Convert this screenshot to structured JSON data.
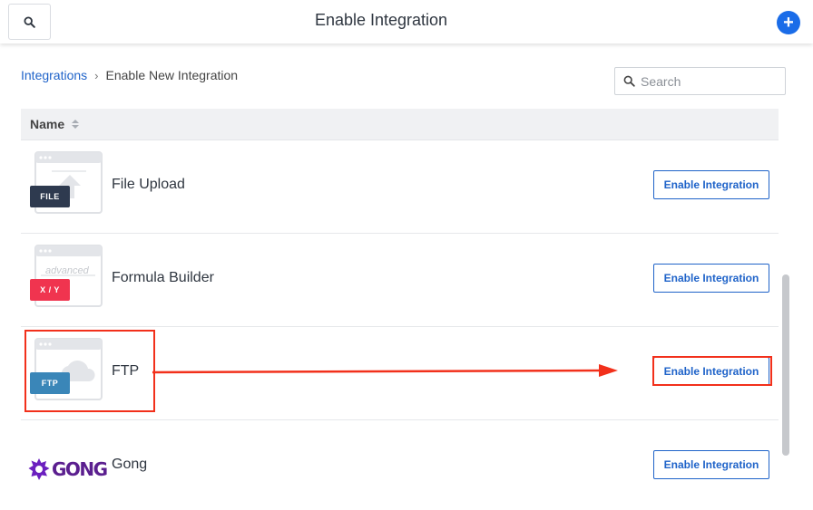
{
  "header": {
    "title": "Enable Integration",
    "search_icon": "search-icon",
    "add_icon": "plus-icon",
    "add_label": "+"
  },
  "breadcrumb": {
    "root": "Integrations",
    "separator": "›",
    "current": "Enable New Integration"
  },
  "search": {
    "placeholder": "Search",
    "value": ""
  },
  "table": {
    "column_name": "Name",
    "rows": [
      {
        "name": "File Upload",
        "badge": "FILE",
        "badge_color": "#2e3a4f",
        "button": "Enable Integration"
      },
      {
        "name": "Formula Builder",
        "badge": "X / Y",
        "badge_color": "#f0344f",
        "logo_text": "advanced",
        "button": "Enable Integration"
      },
      {
        "name": "FTP",
        "badge": "FTP",
        "badge_color": "#3a86b8",
        "button": "Enable Integration"
      },
      {
        "name": "Gong",
        "logo_text": "GONG",
        "logo_color": "#5b1f8f",
        "button": "Enable Integration"
      }
    ]
  },
  "colors": {
    "accent": "#1f63c9",
    "add_button": "#1a6ce8",
    "highlight": "#f2301b"
  }
}
